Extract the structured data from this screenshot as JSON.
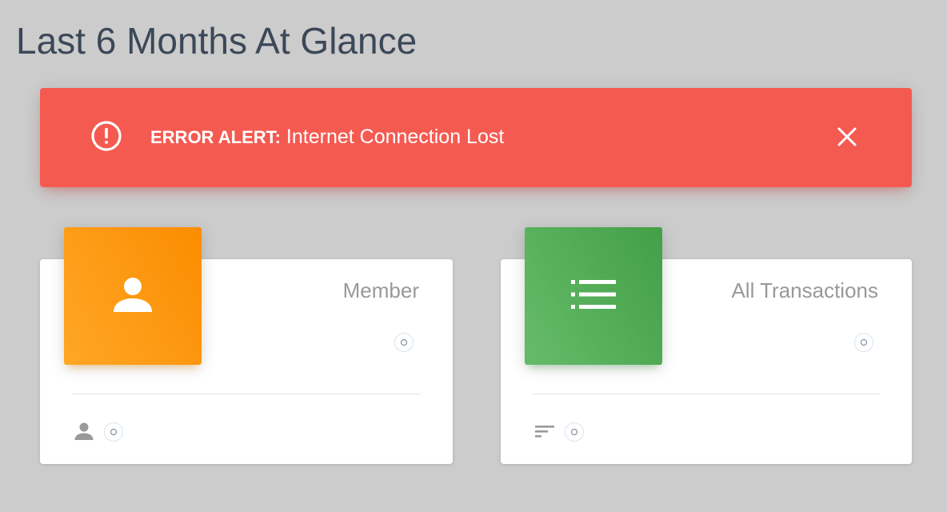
{
  "page": {
    "title": "Last 6 Months At Glance"
  },
  "alert": {
    "label": "ERROR ALERT:",
    "message": " Internet Connection Lost",
    "icon": "error-circle-icon",
    "close_icon": "close-icon",
    "color": "#f55a51"
  },
  "cards": [
    {
      "category": "Member",
      "icon": "person-icon",
      "color": "#fb8c00",
      "footer_icon": "person-icon"
    },
    {
      "category": "All Transactions",
      "icon": "list-icon",
      "color": "#43a047",
      "footer_icon": "sort-icon"
    }
  ]
}
